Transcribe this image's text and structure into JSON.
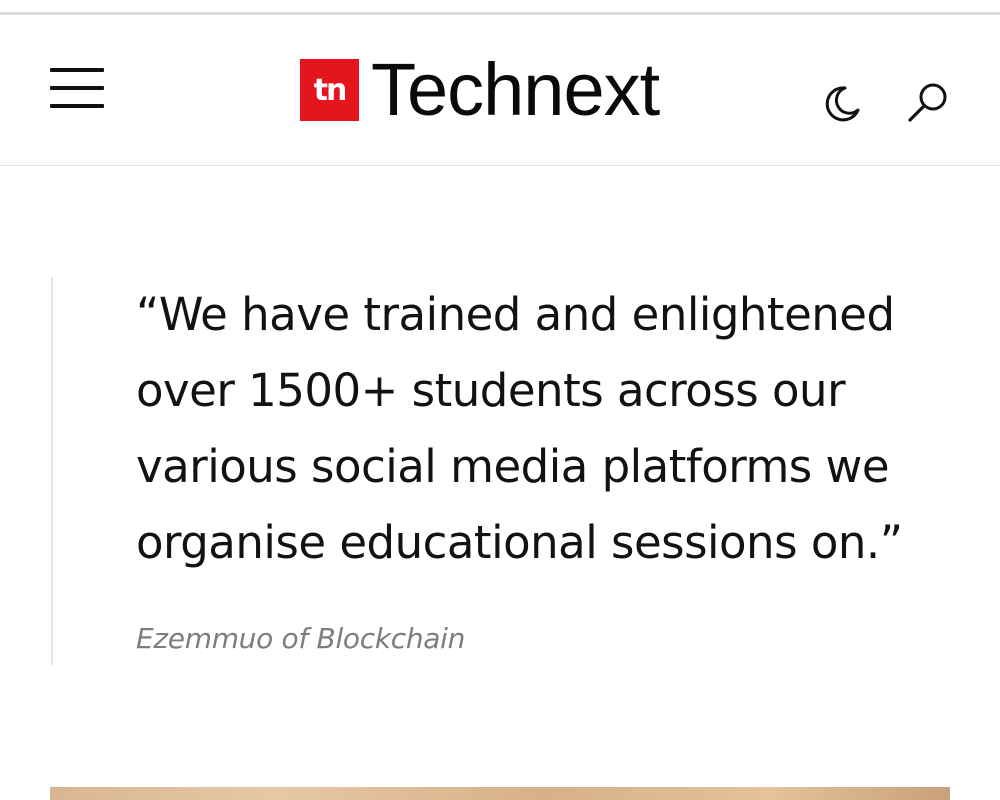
{
  "header": {
    "logo_badge": "tn",
    "logo_text": "Technext",
    "brand_color": "#e4151c",
    "menu_icon": "hamburger-menu-icon",
    "theme_icon": "moon-icon",
    "search_icon": "search-icon"
  },
  "quote": {
    "lines": [
      "“We have trained and enlightened",
      "over 1500+ students across our",
      "various social media platforms we",
      "organise educational sessions on.”"
    ],
    "citation": "Ezemmuo of Blockchain"
  }
}
